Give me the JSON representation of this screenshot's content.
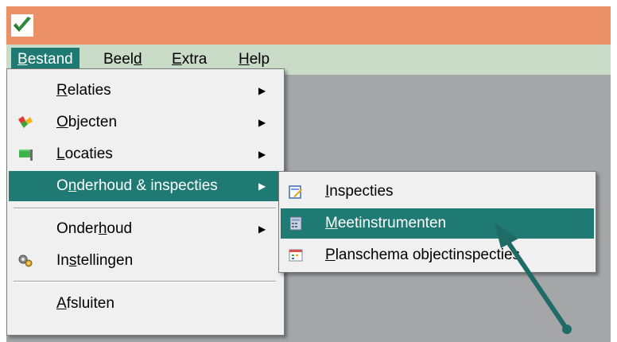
{
  "menubar": {
    "items": [
      {
        "pre": "",
        "ul": "B",
        "post": "estand"
      },
      {
        "pre": "Beel",
        "ul": "d",
        "post": ""
      },
      {
        "pre": "",
        "ul": "E",
        "post": "xtra"
      },
      {
        "pre": "",
        "ul": "H",
        "post": "elp"
      }
    ]
  },
  "dropdown": {
    "items": [
      {
        "pre": "",
        "ul": "R",
        "post": "elaties",
        "icon": "none"
      },
      {
        "pre": "",
        "ul": "O",
        "post": "bjecten",
        "icon": "objects-icon"
      },
      {
        "pre": "",
        "ul": "L",
        "post": "ocaties",
        "icon": "locations-icon"
      },
      {
        "pre": "O",
        "ul": "n",
        "post": "derhoud & inspecties",
        "icon": "none"
      },
      {
        "pre": "Onder",
        "ul": "h",
        "post": "oud",
        "icon": "none"
      },
      {
        "pre": "In",
        "ul": "s",
        "post": "tellingen",
        "icon": "settings-icon"
      },
      {
        "pre": "",
        "ul": "A",
        "post": "fsluiten",
        "icon": "none"
      }
    ],
    "arrow_glyph": "▶"
  },
  "submenu": {
    "items": [
      {
        "pre": "",
        "ul": "I",
        "post": "nspecties",
        "icon": "inspections-icon"
      },
      {
        "pre": "",
        "ul": "M",
        "post": "eetinstrumenten",
        "icon": "meters-icon"
      },
      {
        "pre": "",
        "ul": "P",
        "post": "lanschema objectinspecties",
        "icon": "schedule-icon"
      }
    ]
  },
  "colors": {
    "titlebar": "#ec9068",
    "menubar": "#c9dcc8",
    "highlight": "#1f7a74",
    "workspace": "#a5a6a8",
    "annotation_arrow": "#1f6b66"
  }
}
